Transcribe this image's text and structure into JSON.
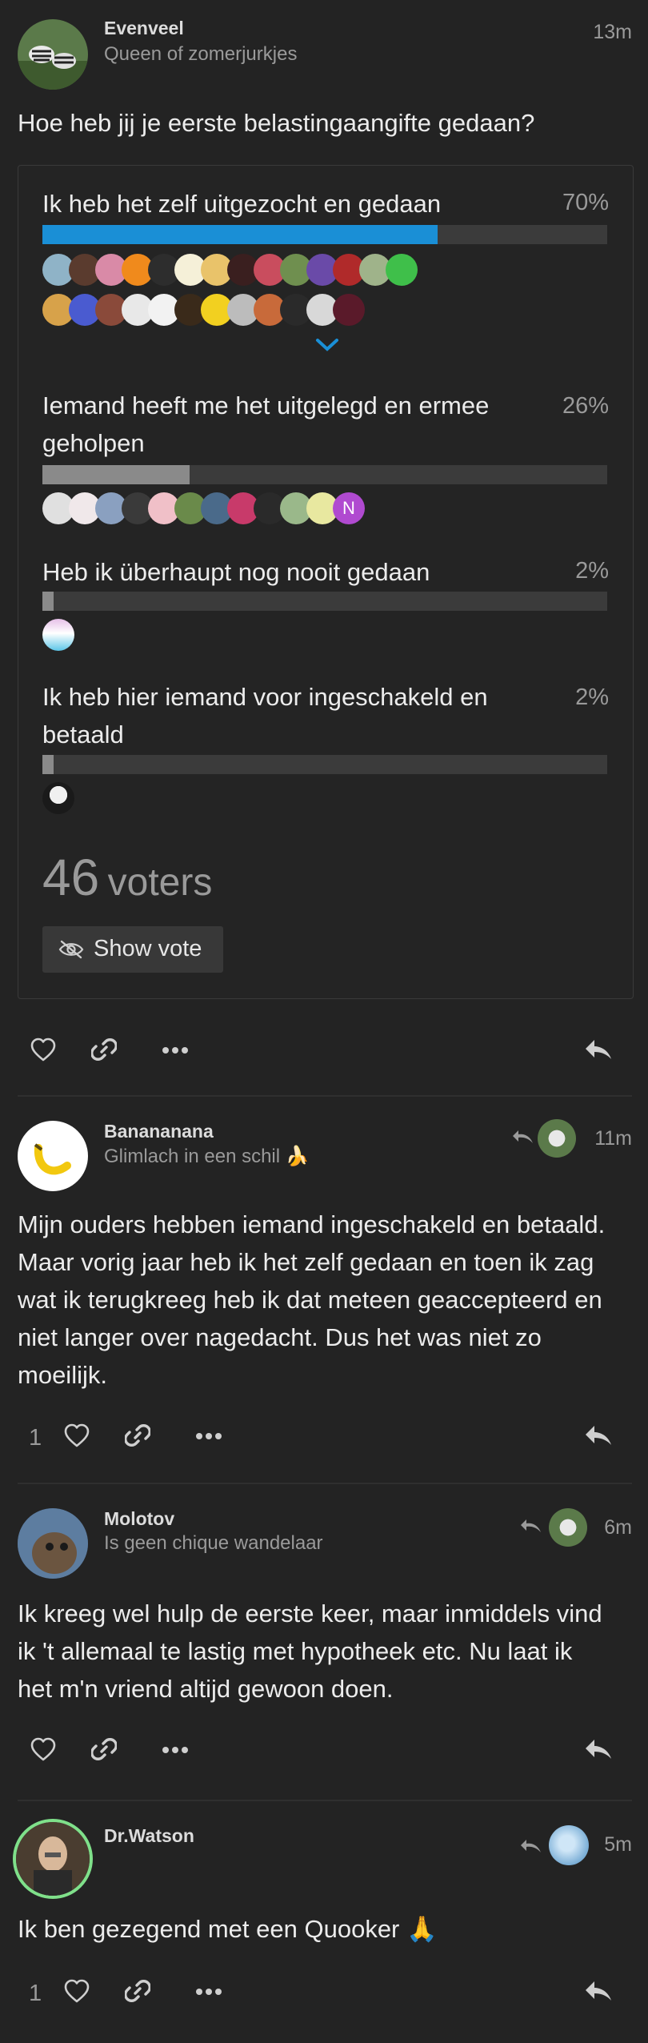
{
  "post": {
    "author": "Evenveel",
    "tagline": "Queen of zomerjurkjes",
    "time": "13m",
    "question": "Hoe heb jij je eerste belastingaangifte gedaan?"
  },
  "poll": {
    "options": [
      {
        "label_lines": [
          "Ik heb het zelf uitgezocht en gedaan"
        ],
        "percent_label": "70%",
        "fraction": 0.7,
        "color": "#1a8fd6"
      },
      {
        "label_lines": [
          "Iemand heeft me het uitgelegd en ermee",
          "geholpen"
        ],
        "percent_label": "26%",
        "fraction": 0.26,
        "color": "#8a8a8a"
      },
      {
        "label_lines": [
          "Heb ik überhaupt nog nooit gedaan"
        ],
        "percent_label": "2%",
        "fraction": 0.02,
        "color": "#8a8a8a"
      },
      {
        "label_lines": [
          "Ik heb hier iemand voor ingeschakeld en",
          "betaald"
        ],
        "percent_label": "2%",
        "fraction": 0.02,
        "color": "#8a8a8a"
      }
    ],
    "voters_count": "46",
    "voters_label": "voters",
    "show_vote_label": "Show vote",
    "voter_initial": "N",
    "accent_color": "#1a8fd6"
  },
  "post_actions": {
    "like_count": ""
  },
  "comments": [
    {
      "author": "Banananana",
      "tagline": "Glimlach in een schil 🍌",
      "time": "11m",
      "lines": [
        "Mijn ouders hebben iemand ingeschakeld en betaald.",
        "Maar vorig jaar heb ik het zelf gedaan en toen ik zag",
        "wat ik terugkreeg heb ik dat meteen geaccepteerd en",
        "niet langer over nagedacht. Dus het was niet zo",
        "moeilijk."
      ],
      "like_count": "1"
    },
    {
      "author": "Molotov",
      "tagline": "Is geen chique wandelaar",
      "time": "6m",
      "lines": [
        "Ik kreeg wel hulp de eerste keer, maar inmiddels vind",
        "ik 't allemaal te lastig met hypotheek etc. Nu laat ik",
        "het m'n vriend altijd gewoon doen."
      ],
      "like_count": ""
    },
    {
      "author": "Dr.Watson",
      "tagline": "",
      "time": "5m",
      "lines": [
        "Ik ben gezegend met een Quooker 🙏"
      ],
      "like_count": "1"
    }
  ]
}
